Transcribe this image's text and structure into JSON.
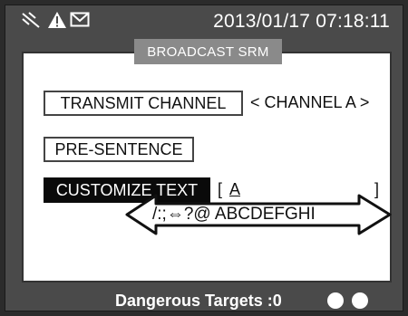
{
  "status_bar": {
    "icons": [
      "no-signal-icon",
      "warning-icon",
      "mail-icon"
    ],
    "datetime": "2013/01/17 07:18:11"
  },
  "panel": {
    "title": "BROADCAST SRM",
    "transmit_channel_label": "TRANSMIT CHANNEL",
    "channel_value": "< CHANNEL A >",
    "pre_sentence_label": "PRE-SENTENCE",
    "customize_text_label": "CUSTOMIZE TEXT",
    "text_open_bracket": "[",
    "text_value": "A",
    "text_close_bracket": "]",
    "char_selector": "/:;⇔?@   ABCDEFGHI"
  },
  "bottom_bar": {
    "warning": "Dangerous Targets :0",
    "indicator_count": 2
  },
  "colors": {
    "bezel": "#2b2b2b",
    "screen": "#4a4a4a",
    "panel_bg": "#ffffff",
    "title_bg": "#8a8a8a",
    "selected_bg": "#0a0a0a"
  }
}
